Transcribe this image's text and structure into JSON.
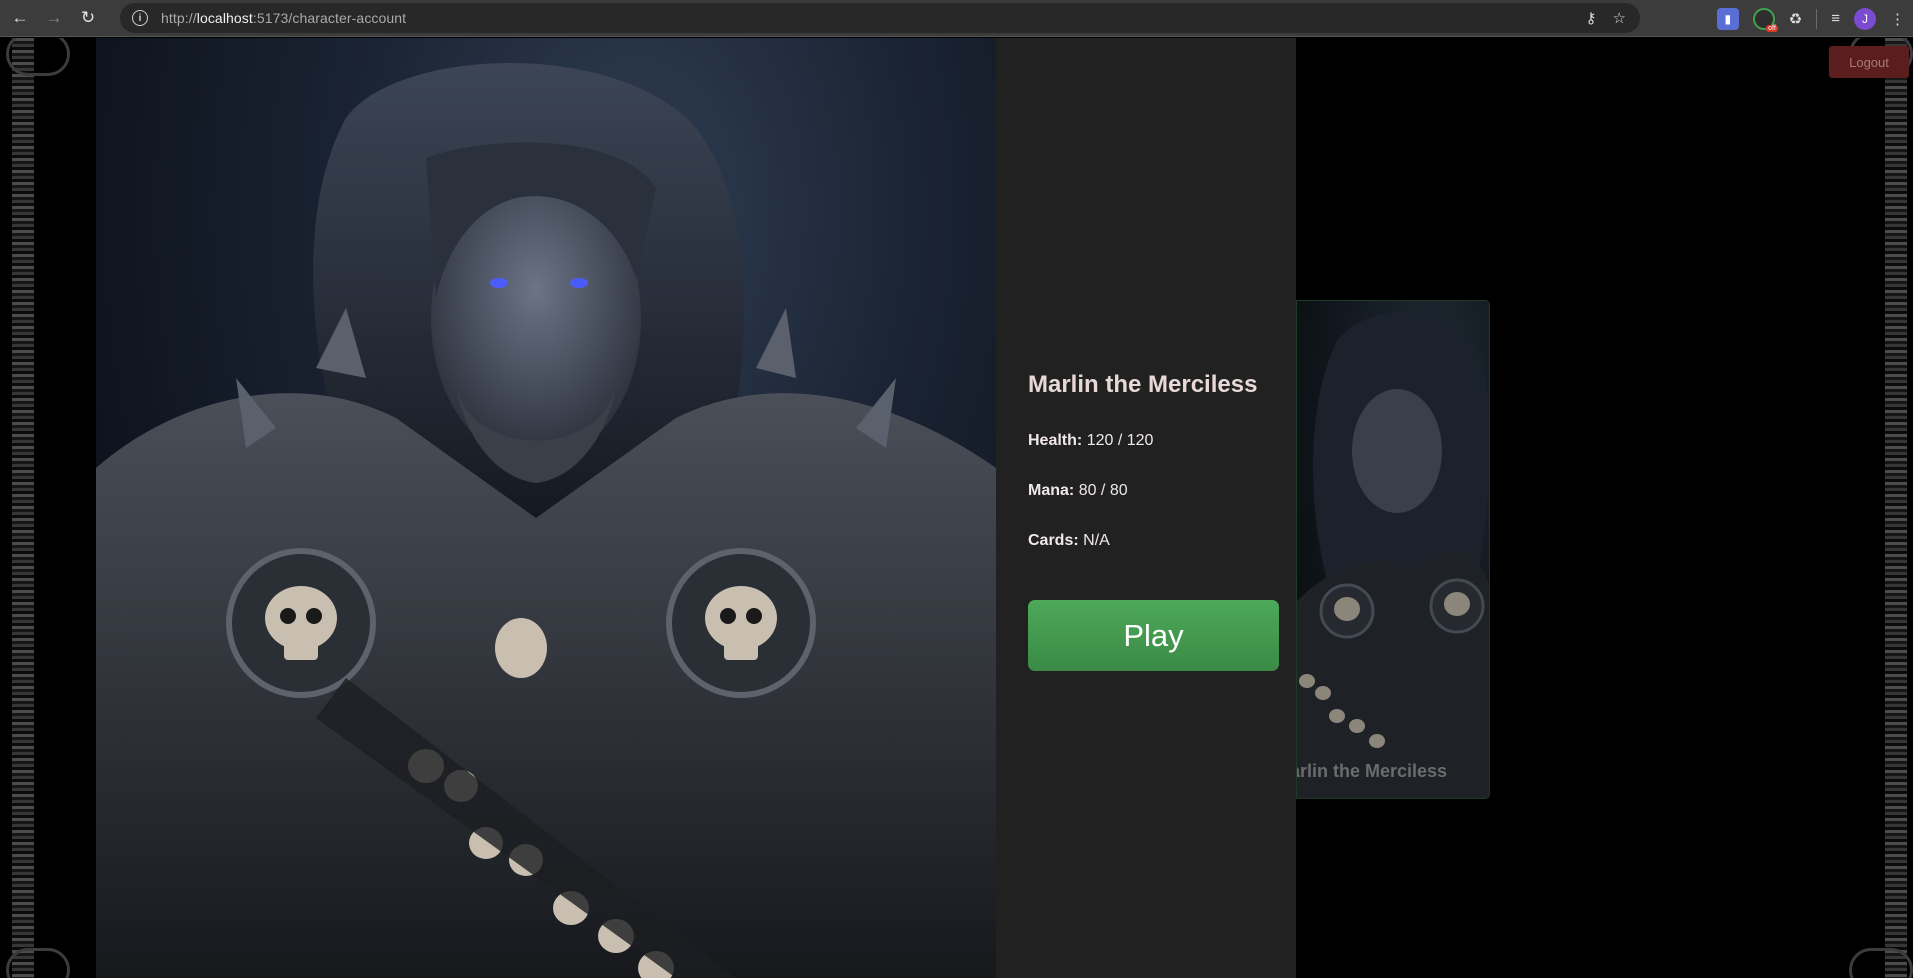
{
  "browser": {
    "url_prefix": "http://",
    "url_host": "localhost",
    "url_path": ":5173/character-account",
    "avatar_letter": "J",
    "ext_badge": "off",
    "icons": [
      "back-icon",
      "forward-icon",
      "reload-icon",
      "site-info-icon",
      "password-key-icon",
      "bookmark-star-icon",
      "extensions-icon",
      "reading-list-icon",
      "menu-icon"
    ]
  },
  "page": {
    "logout_label": "Logout",
    "character": {
      "name": "Marlin the Merciless",
      "health_label": "Health:",
      "health_value": "120 / 120",
      "mana_label": "Mana:",
      "mana_value": "80 / 80",
      "cards_label": "Cards:",
      "cards_value": "N/A"
    },
    "play_label": "Play",
    "card_name": "Marlin the Merciless"
  },
  "colors": {
    "play_button": "#43a04f",
    "logout_button": "#5b1d1d",
    "panel_bg": "#212121",
    "name_color": "#e9d8d8"
  }
}
